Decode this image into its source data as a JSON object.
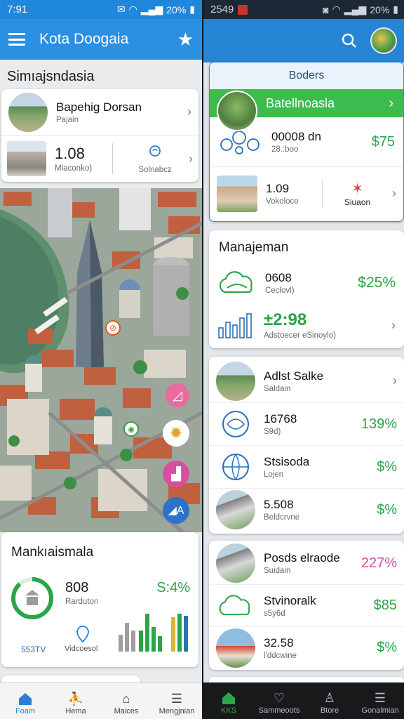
{
  "left": {
    "status": {
      "time": "7:91",
      "battery": "20%"
    },
    "appbar": {
      "title": "Kota Doogaia"
    },
    "section_title": "Simıajsndasia",
    "top_card": {
      "row1": {
        "name": "Bapehig Dorsan",
        "sub": "Pajain"
      },
      "row2": {
        "value": "1.08",
        "sub": "Mlaconko)",
        "side_label": "Solnabcz"
      }
    },
    "bottom_card": {
      "title": "Mankıaismala",
      "value": "808",
      "sub": "Rarduton",
      "percent": "S:4%",
      "left_label": "553TV",
      "mid_label": "Vidcoesol",
      "bars_green": [
        0.55,
        1.0,
        0.65,
        0.4
      ],
      "bars_grey": [
        0.45,
        0.75,
        0.55
      ],
      "bars_gold": [
        0.9,
        1.0,
        0.95
      ]
    },
    "bottom_nav": [
      {
        "label": "Foam",
        "icon": "home-icon",
        "active": true
      },
      {
        "label": "Hema",
        "icon": "person-icon",
        "active": false
      },
      {
        "label": "Maices",
        "icon": "building-icon",
        "active": false
      },
      {
        "label": "Mengjnian",
        "icon": "list-icon",
        "active": false
      }
    ]
  },
  "right": {
    "status": {
      "time": "2549",
      "battery": "20%"
    },
    "card1": {
      "header": "Boders",
      "banner": "Batellnoasla",
      "row1": {
        "name": "00008 dn",
        "sub": "28.:boo",
        "value": "$75"
      },
      "row2": {
        "name": "1.09",
        "sub": "Vokoloce",
        "side_label": "Siuaon"
      }
    },
    "card2": {
      "title": "Manajeman",
      "row1": {
        "name": "0608",
        "sub": "Ceclovl)",
        "value": "$25%"
      },
      "row2": {
        "name": "±2:98",
        "sub": "Adstoecer eSinoylo)"
      }
    },
    "card3": {
      "rows": [
        {
          "name": "Adlst Salke",
          "sub": "Saldain",
          "value": ""
        },
        {
          "name": "16768",
          "sub": "S9d)",
          "value": "139%"
        },
        {
          "name": "Stsisoda",
          "sub": "Lojen",
          "value": "$%"
        },
        {
          "name": "5.508",
          "sub": "Beldcrvne",
          "value": "$%"
        }
      ]
    },
    "card4": {
      "rows": [
        {
          "name": "Posds elraode",
          "sub": "Suidain",
          "value": "227%"
        },
        {
          "name": "Stvinoralk",
          "sub": "s5y6d",
          "value": "$85"
        },
        {
          "name": "32.58",
          "sub": "l'ddcwine",
          "value": "$%"
        }
      ]
    },
    "bottom_nav": [
      {
        "label": "KKS",
        "icon": "home-icon",
        "active": true
      },
      {
        "label": "Sammeoots",
        "icon": "heart-icon",
        "active": false
      },
      {
        "label": "Btore",
        "icon": "person-icon",
        "active": false
      },
      {
        "label": "Gonalmian",
        "icon": "list-icon",
        "active": false
      }
    ]
  },
  "colors": {
    "primary_blue": "#2b8fe2",
    "green": "#29a545",
    "pink": "#d34aa3",
    "dark_nav": "#17191b"
  }
}
